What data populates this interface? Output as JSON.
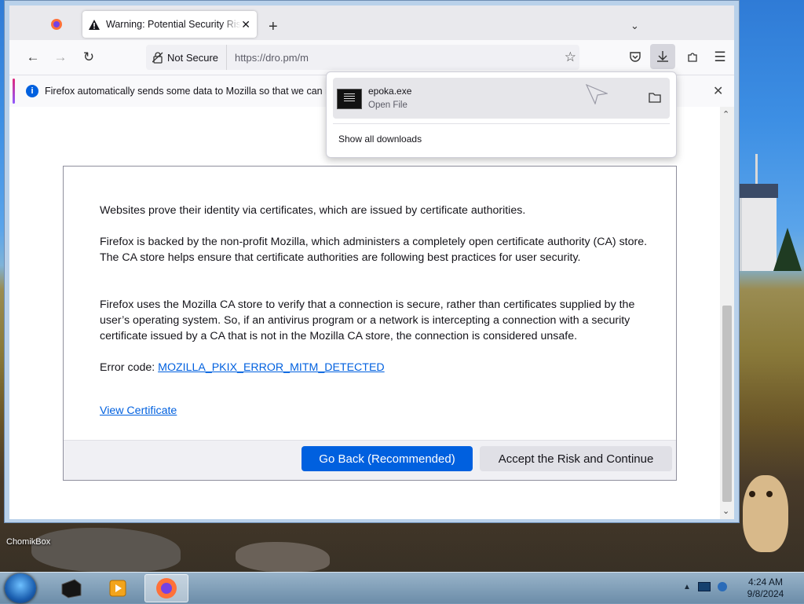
{
  "browser": {
    "tabs": [
      {
        "title": "Warning: Potential Security Risk"
      }
    ],
    "url": "https://dro.pm/m",
    "security_label": "Not Secure"
  },
  "notification": {
    "message": "Firefox automatically sends some data to Mozilla so that we can im"
  },
  "downloads_panel": {
    "items": [
      {
        "filename": "epoka.exe",
        "status": "Open File"
      }
    ],
    "show_all": "Show all downloads"
  },
  "page": {
    "paragraph1": "Websites prove their identity via certificates, which are issued by certificate authorities.",
    "paragraph2": "Firefox is backed by the non-profit Mozilla, which administers a completely open certificate authority (CA) store. The CA store helps ensure that certificate authorities are following best practices for user security.",
    "paragraph3": "Firefox uses the Mozilla CA store to verify that a connection is secure, rather than certificates supplied by the user’s operating system. So, if an antivirus program or a network is intercepting a connection with a security certificate issued by a CA that is not in the Mozilla CA store, the connection is considered unsafe.",
    "error_code_label": "Error code: ",
    "error_code": "MOZILLA_PKIX_ERROR_MITM_DETECTED",
    "view_certificate": "View Certificate",
    "go_back_button": "Go Back (Recommended)",
    "accept_button": "Accept the Risk and Continue"
  },
  "desktop": {
    "icon_label": "ChomikBox"
  },
  "taskbar": {
    "time": "4:24 AM",
    "date": "9/8/2024"
  },
  "colors": {
    "accent": "#0060df",
    "window_frame": "#b9d1ea"
  }
}
